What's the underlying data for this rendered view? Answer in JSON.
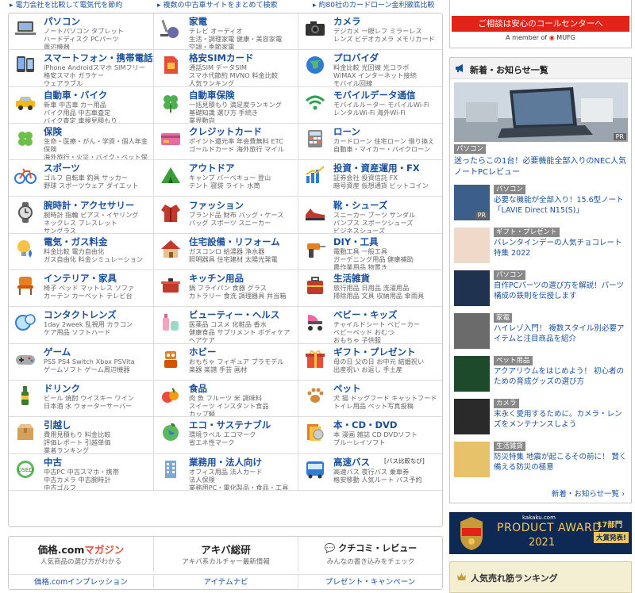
{
  "topLinks": [
    "電力会社を比較して電気代を節約",
    "複数の中古車サイトをまとめて検索",
    "約80社のカードローン金利徹底比較"
  ],
  "categories": [
    {
      "title": "パソコン",
      "sub": "ノートパソコン タブレット\nハードディスク PCパーツ\n周辺機器",
      "icon": "laptop-icon"
    },
    {
      "title": "家電",
      "sub": "テレビ オーディオ\n生活・調理家電 健康・美容家電\n空調・季節家電",
      "icon": "vacuum-icon"
    },
    {
      "title": "カメラ",
      "sub": "デジカメ 一眼レフ ミラーレス\nレンズ ビデオカメラ メモリカード",
      "icon": "camera-icon"
    },
    {
      "title": "スマートフォン・携帯電話",
      "sub": "iPhone Androidスマホ SIMフリー\n格安スマホ ガラケー\nウェアラブル",
      "icon": "smartphone-icon"
    },
    {
      "title": "格安SIMカード",
      "sub": "通話SIM データSIM\nスマホ代節約 MVNO 料金比較\n人気ランキング",
      "icon": "sim-card-icon"
    },
    {
      "title": "プロバイダ",
      "sub": "料金比較 光回線 光コラボ\nWiMAX インターネット接続\nモバイル回線",
      "icon": "globe-icon"
    },
    {
      "title": "自動車・バイク",
      "sub": "新車 中古車 カー用品\nバイク用品 中古車査定\nバイク査定 車検見積もり",
      "icon": "car-icon"
    },
    {
      "title": "自動車保険",
      "sub": "一括見積もり 満足度ランキング\n基礎知識 選び方 手続き\n業界動向",
      "icon": "clover-icon"
    },
    {
      "title": "モバイルデータ通信",
      "sub": "モバイルルーター モバイルWi-Fi\nレンタルWi-Fi 海外Wi-Fi",
      "icon": "wifi-icon"
    },
    {
      "title": "保険",
      "sub": "生命・医療・がん・学資・個人年金保険\n海外旅行・火災・バイク・ペット保険",
      "icon": "clover-leaf-icon"
    },
    {
      "title": "クレジットカード",
      "sub": "ポイント還元率 年会費無料 ETC\nゴールドカード 海外旅行 マイル",
      "icon": "credit-card-icon"
    },
    {
      "title": "ローン",
      "sub": "カードローン 住宅ローン 借り換え\n自動車・マイカー・バイクローン",
      "icon": "calculator-icon"
    },
    {
      "title": "スポーツ",
      "sub": "ゴルフ 自転車 釣具 サッカー\n野球 スポーツウェア ダイエット",
      "icon": "bicycle-icon"
    },
    {
      "title": "アウトドア",
      "sub": "キャンプ バーベキュー 登山\nテント 寝袋 ライト 水筒",
      "icon": "tent-icon"
    },
    {
      "title": "投資・資産運用・FX",
      "sub": "証券会社 投資信託 FX\n暗号資産 仮想通貨 ビットコイン",
      "icon": "chart-icon"
    },
    {
      "title": "腕時計・アクセサリー",
      "sub": "腕時計 指輪 ピアス・イヤリング\nネックレス ブレスレット\nサングラス",
      "icon": "watch-icon"
    },
    {
      "title": "ファッション",
      "sub": "ブランド品 財布 バッグ・ケース\nバッグ スポーツ スニーカー",
      "icon": "coat-icon"
    },
    {
      "title": "靴・シューズ",
      "sub": "スニーカー ブーツ サンダル\nパンプス スポーツシューズ\nビジネスシューズ",
      "icon": "shoe-icon"
    },
    {
      "title": "電気・ガス料金",
      "sub": "料金比較 電力自由化\nガス自由化 料金シミュレーション",
      "icon": "bulb-icon"
    },
    {
      "title": "住宅設備・リフォーム",
      "sub": "ガスコンロ 給湯器 浄水器\n照明器具 住宅建材 太陽光発電",
      "icon": "house-icon"
    },
    {
      "title": "DIY・工具",
      "sub": "電動工具 一般工具\nガーデニング用品 健康補助\n農作業用品 物置き",
      "icon": "drill-icon"
    },
    {
      "title": "インテリア・家具",
      "sub": "椅子 ベッド マットレス ソファ\nカーテン カーペット テレビ台",
      "icon": "chair-icon"
    },
    {
      "title": "キッチン用品",
      "sub": "鍋 フライパン 食器 グラス\nカトラリー 食洗 調理器具 弁当箱",
      "icon": "pot-icon"
    },
    {
      "title": "生活雑貨",
      "sub": "旅行用品 日用品 洗濯用品\n掃除用品 文具 収納用品 傘雨具",
      "icon": "suitcase-icon"
    },
    {
      "title": "コンタクトレンズ",
      "sub": "1day 2week 乱視用 カラコン\nケア用品 ソフトハード",
      "icon": "lens-icon"
    },
    {
      "title": "ビューティー・ヘルス",
      "sub": "医薬品 コスメ 化粧品 香水\n健康食品 サプリメント ボディケア\nヘアケア",
      "icon": "cosmetics-icon"
    },
    {
      "title": "ベビー・キッズ",
      "sub": "チャイルドシート ベビーカー\nベビーベッド おむつ\nおもちゃ 子供服",
      "icon": "stroller-icon"
    },
    {
      "title": "ゲーム",
      "sub": "PS5 PS4 Switch Xbox PSVita\nゲームソフト ゲーム周辺機器",
      "icon": "gamepad-icon"
    },
    {
      "title": "ホビー",
      "sub": "おもちゃ フィギュア プラモデル\n楽器 楽譜 手芸 画材",
      "icon": "robot-icon"
    },
    {
      "title": "ギフト・プレゼント",
      "sub": "母の日 父の日 お中元 結婚祝い\n出産祝い お返し 手土産",
      "icon": "gift-icon"
    },
    {
      "title": "ドリンク",
      "sub": "ビール 焼酎 ウイスキー ワイン\n日本酒 水 ウォーターサーバー",
      "icon": "bottle-icon"
    },
    {
      "title": "食品",
      "sub": "肉 魚 フルーツ 米 調味料\nスイーツ インスタント食品\nカップ麺",
      "icon": "food-icon"
    },
    {
      "title": "ペット",
      "sub": "犬 猫 ドッグフード キャットフード\nトイレ用品 ペット写真投稿",
      "icon": "paw-icon"
    },
    {
      "title": "引越し",
      "sub": "費用見積もり 料金比較\n評価レポート 引越単価\n業者ランキング",
      "icon": "moving-box-icon"
    },
    {
      "title": "エコ・サステナブル",
      "sub": "環境ラベル エコマーク\n省エネ性マーク",
      "icon": "eco-globe-icon"
    },
    {
      "title": "本・CD・DVD",
      "sub": "本 漫画 雑誌 CD DVDソフト\nブルーレイソフト",
      "icon": "book-icon"
    },
    {
      "title": "中古",
      "sub": "中古PC 中古スマホ・携帯\n中古カメラ 中古腕時計\n中古ゴルフ",
      "icon": "used-badge-icon"
    },
    {
      "title": "業務用・法人向け",
      "sub": "オフィス用品 法人カード\n法人保険\n業務用PC・電化製品・食品・工具",
      "icon": "building-icon"
    },
    {
      "title": "高速バス",
      "titleSmall": "[バス比較なび]",
      "sub": "高速バス 夜行バス 乗車券\n格安移動 人気ルート バス予約",
      "icon": "bus-icon"
    }
  ],
  "bottomLinks": {
    "magazine": {
      "logo": "価格.com",
      "logoAccent": "マガジン",
      "caption": "人気商品の選び方がわかる"
    },
    "akiba": {
      "logo": "アキバ総研",
      "caption": "アキバ系カルチャー最新情報"
    },
    "kuchikomi": {
      "logo": "クチコミ・レビュー",
      "caption": "みんなの書き込みをチェック"
    },
    "links": [
      "価格.comインプレッション",
      "アイテムナビ",
      "プレゼント・キャンペーン"
    ]
  },
  "callCenter": {
    "label": "ご相談は安心のコールセンターへ",
    "footer": "A member of",
    "brand": "MUFG"
  },
  "news": {
    "title": "新着・お知らせ一覧",
    "hero": {
      "tag": "パソコン",
      "text": "迷ったらこの1台！必要機能全部入りのNEC人気ノートPCレビュー",
      "pr": "PR"
    },
    "items": [
      {
        "tag": "パソコン",
        "text": "必要な機能が全部入り！15.6型ノート「LAVIE Direct N15(S)」",
        "pr": "PR"
      },
      {
        "tag": "ギフト・プレゼント",
        "text": "バレンタインデーの人気チョコレート特集 2022"
      },
      {
        "tag": "パソコン",
        "text": "自作PCパーツの選び方を解説！パーツ構成の鉄則を伝授します"
      },
      {
        "tag": "家電",
        "text": "ハイレゾ入門！ 複数スタイル別必要アイテムと注目商品を紹介"
      },
      {
        "tag": "ペット用品",
        "text": "アクアリウムをはじめよう！ 初心者のための育成グッズの選び方"
      },
      {
        "tag": "カメラ",
        "text": "末永く愛用するために。カメラ・レンズをメンテナンスしよう"
      },
      {
        "tag": "生活雑貨",
        "text": "防災特集 地震が起こるその前に！ 賢く備える防災の極意"
      }
    ],
    "more": "新着・お知らせ一覧 ›"
  },
  "award": {
    "site": "kakaku.com",
    "title": "PRODUCT AWARD",
    "year": "2021",
    "count": "17部門",
    "badge": "大賞発表!"
  },
  "ranking": {
    "title": "人気売れ筋ランキング"
  },
  "colors": {
    "link": "#1a4f9c",
    "red": "#e2231a",
    "navy": "#0e2a54",
    "gold": "#f0c75e"
  }
}
